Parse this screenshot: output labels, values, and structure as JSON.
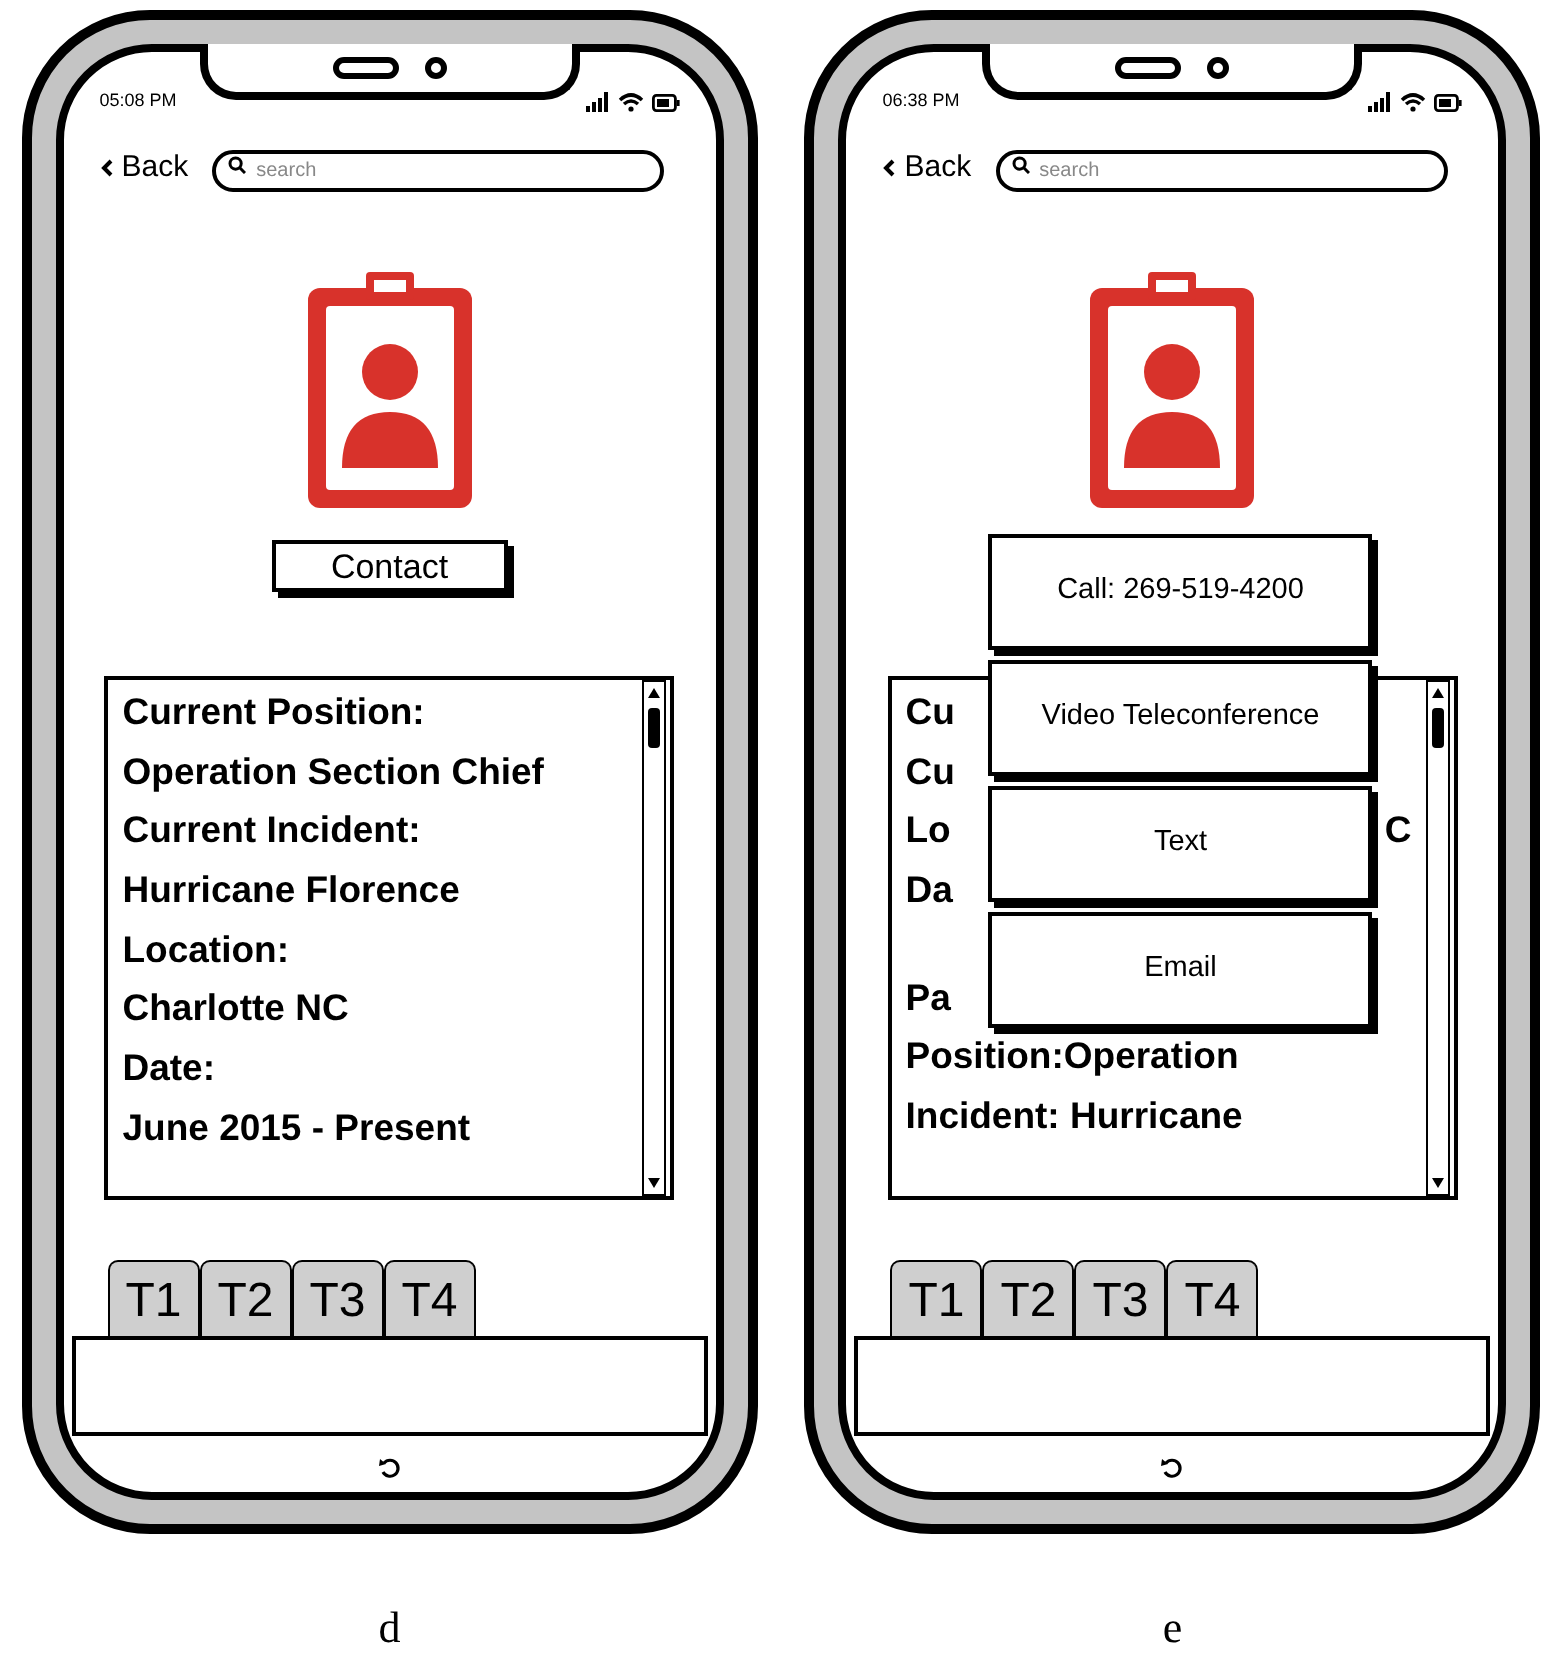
{
  "phones": [
    {
      "caption": "d",
      "status_time": "05:08 PM",
      "back": "Back",
      "search_placeholder": "search",
      "contact_button": "Contact",
      "details": [
        {
          "text": "Current Position:"
        },
        {
          "text": "Operation Section Chief"
        },
        {
          "text": "Current Incident:"
        },
        {
          "text": "Hurricane Florence"
        },
        {
          "text": "Location:"
        },
        {
          "text": "Charlotte NC"
        },
        {
          "text": "Date:"
        },
        {
          "text": "June 2015 - Present"
        }
      ],
      "tabs": [
        {
          "label": "T1"
        },
        {
          "label": "T2"
        },
        {
          "label": "T3"
        },
        {
          "label": "T4"
        }
      ]
    },
    {
      "caption": "e",
      "status_time": "06:38 PM",
      "back": "Back",
      "search_placeholder": "search",
      "details": [
        {
          "text": "Cu"
        },
        {
          "text": "Cu"
        },
        {
          "text": "Lo",
          "tail": "C"
        },
        {
          "text": "Da"
        },
        {
          "text": "Pa",
          "spaced": true
        },
        {
          "text": "Position:Operation"
        },
        {
          "text": "Incident: Hurricane"
        }
      ],
      "menu": [
        {
          "label": "Call: 269-519-4200"
        },
        {
          "label": "Video Teleconference"
        },
        {
          "label": "Text"
        },
        {
          "label": "Email"
        }
      ],
      "tabs": [
        {
          "label": "T1"
        },
        {
          "label": "T2"
        },
        {
          "label": "T3"
        },
        {
          "label": "T4"
        }
      ]
    }
  ]
}
